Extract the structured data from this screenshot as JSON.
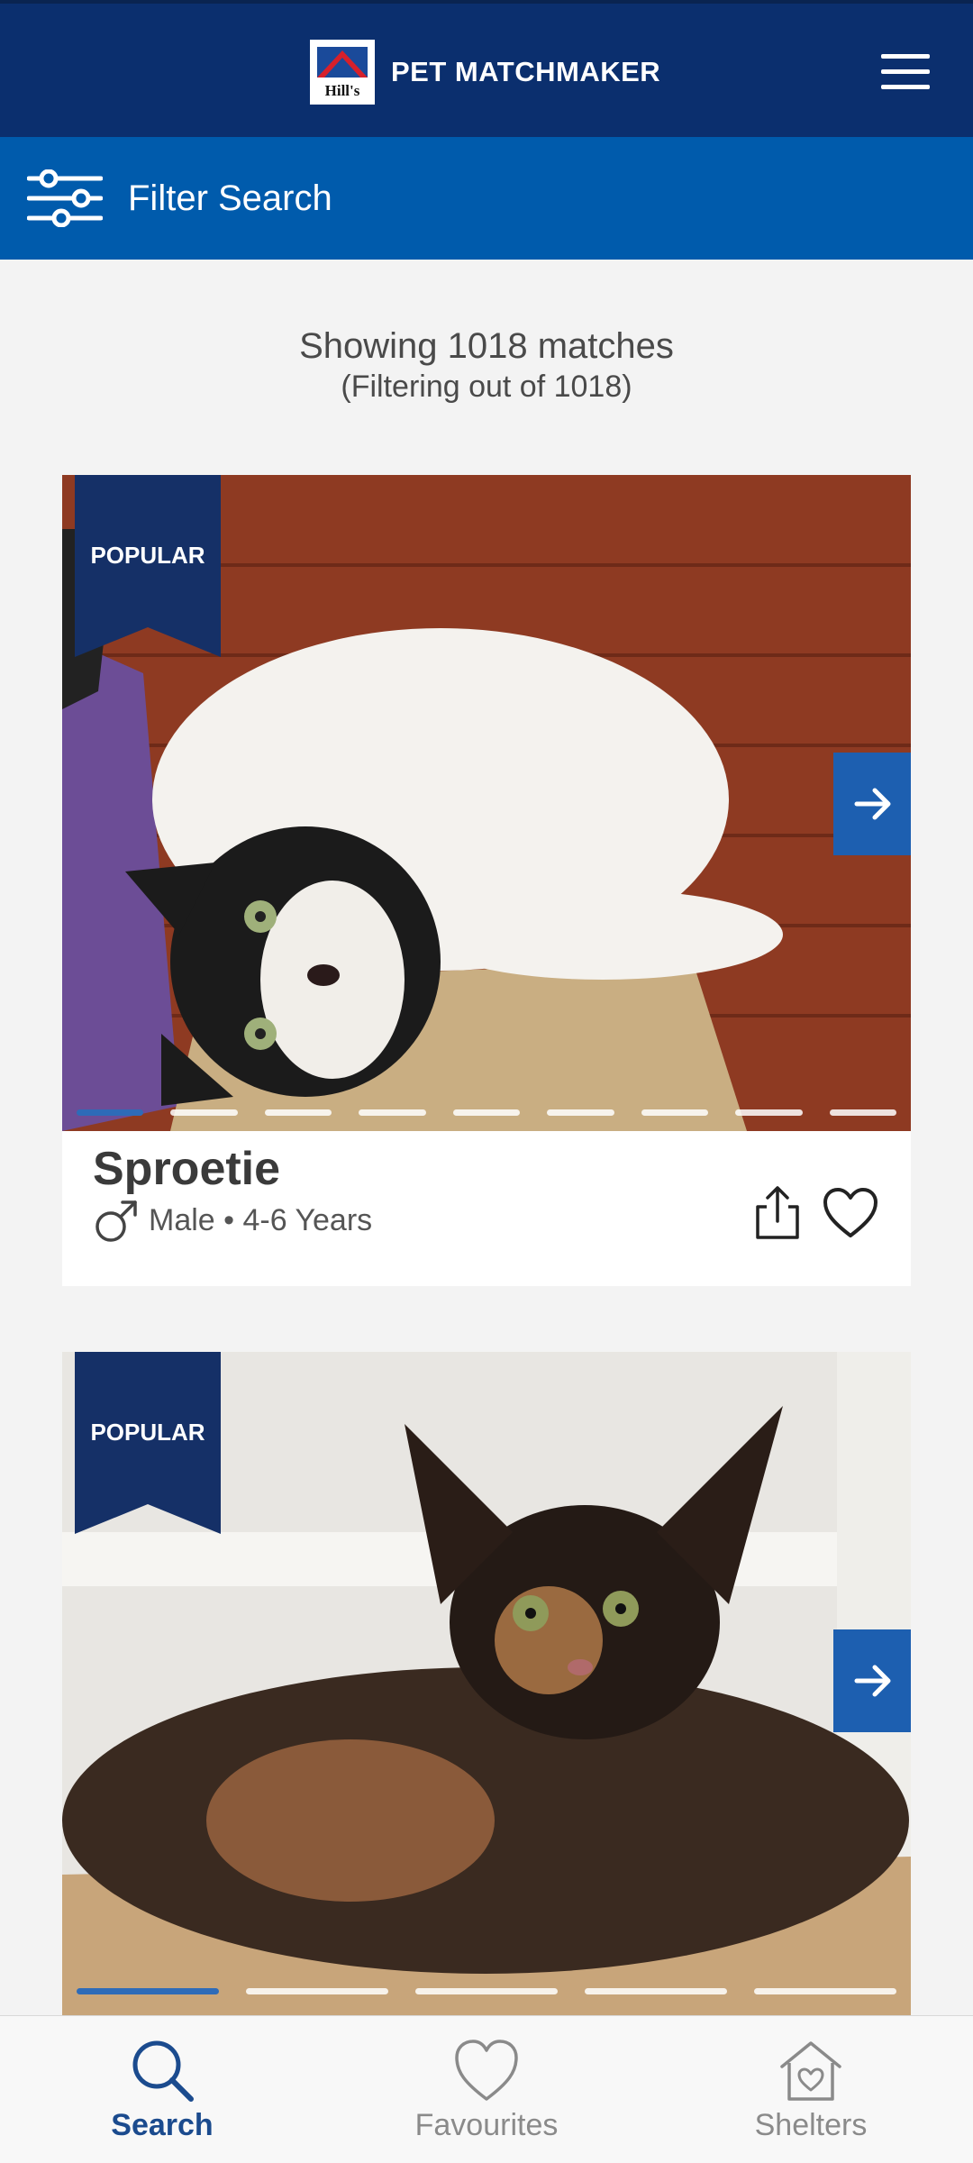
{
  "header": {
    "logo_text": "Hill's",
    "title": "PET MATCHMAKER",
    "menu_icon": "hamburger-menu-icon"
  },
  "filter_bar": {
    "label": "Filter Search",
    "icon": "sliders-icon"
  },
  "results": {
    "count_text": "Showing 1018 matches",
    "sub_text": "(Filtering out of 1018)"
  },
  "cards": [
    {
      "badge": "POPULAR",
      "name": "Sproetie",
      "meta": "Male • 4-6 Years",
      "gender_icon": "male-icon",
      "photo_count": 9,
      "active_photo": 0,
      "photo_subject": "black and white cat lying on a ledge"
    },
    {
      "badge": "POPULAR",
      "name": "",
      "meta": "",
      "photo_count": 5,
      "active_photo": 0,
      "photo_subject": "tortoiseshell cat lying on a ledge"
    }
  ],
  "bottom_nav": {
    "items": [
      {
        "label": "Search",
        "icon": "search-icon",
        "active": true
      },
      {
        "label": "Favourites",
        "icon": "heart-icon",
        "active": false
      },
      {
        "label": "Shelters",
        "icon": "house-heart-icon",
        "active": false
      }
    ]
  },
  "colors": {
    "header_navy": "#0b2f6e",
    "filter_blue": "#005bac",
    "ribbon_navy": "#153067",
    "accent_blue": "#1d5fb0",
    "nav_active": "#1b4b8e"
  }
}
